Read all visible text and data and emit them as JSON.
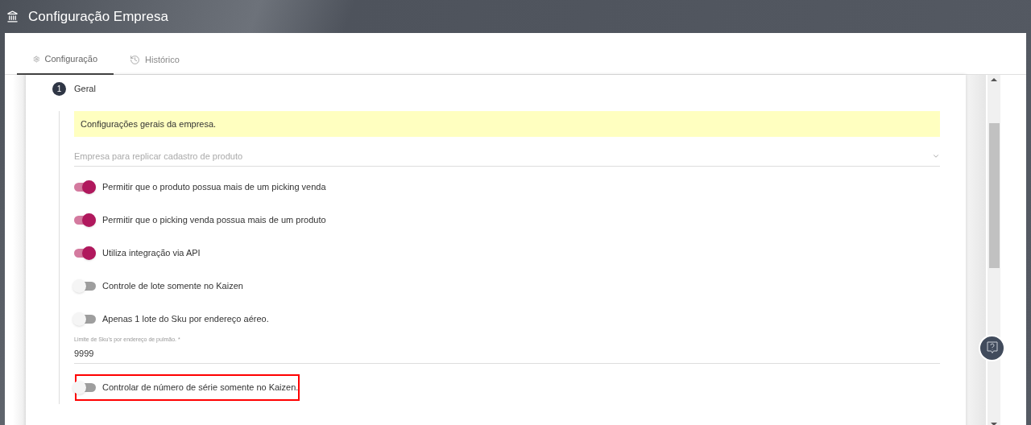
{
  "header": {
    "title": "Configuração Empresa"
  },
  "tabs": [
    {
      "label": "Configuração",
      "selected": true
    },
    {
      "label": "Histórico",
      "selected": false
    }
  ],
  "step": {
    "number": "1",
    "title": "Geral"
  },
  "notice": "Configurações gerais da empresa.",
  "items": [
    {
      "kind": "select",
      "placeholder": "Empresa para replicar cadastro de produto"
    },
    {
      "kind": "toggle",
      "label": "Permitir que o produto possua mais de um picking venda",
      "on": true,
      "highlighted": false
    },
    {
      "kind": "toggle",
      "label": "Permitir que o picking venda possua mais de um produto",
      "on": true,
      "highlighted": false
    },
    {
      "kind": "toggle",
      "label": "Utiliza integração via API",
      "on": true,
      "highlighted": false
    },
    {
      "kind": "toggle",
      "label": "Controle de lote somente no Kaizen",
      "on": false,
      "highlighted": false
    },
    {
      "kind": "toggle",
      "label": "Apenas 1 lote do Sku por endereço aéreo.",
      "on": false,
      "highlighted": false
    },
    {
      "kind": "text",
      "label": "Limite de Sku's por endereço de pulmão. *",
      "value": "9999"
    },
    {
      "kind": "toggle",
      "label": "Controlar de número de série somente no Kaizen.",
      "on": false,
      "highlighted": true
    }
  ]
}
